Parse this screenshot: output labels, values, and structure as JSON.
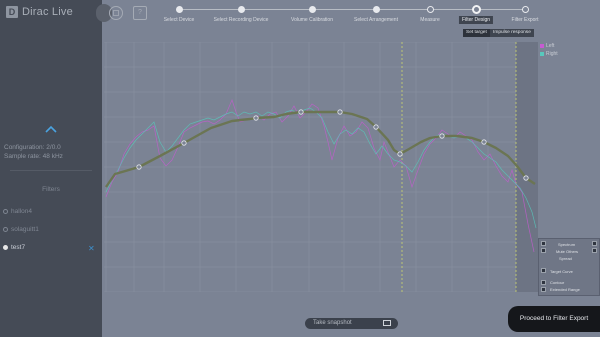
{
  "app": {
    "logo_letter": "D",
    "name": "Dirac Live"
  },
  "sidebar": {
    "configuration": "Configuration: 2/0.0",
    "sample_rate": "Sample rate: 48 kHz",
    "filters_title": "Filters",
    "filters": [
      {
        "label": "hallon4",
        "selected": false
      },
      {
        "label": "solaguitt1",
        "selected": false
      },
      {
        "label": "test7",
        "selected": true
      }
    ],
    "delete_glyph": "✕"
  },
  "toolbar": {
    "save_icon": "save-icon",
    "help_label": "?"
  },
  "steps": [
    {
      "label": "Select Device",
      "state": "done"
    },
    {
      "label": "Select Recording Device",
      "state": "done"
    },
    {
      "label": "Volume Calibration",
      "state": "done"
    },
    {
      "label": "Select Arrangement",
      "state": "done"
    },
    {
      "label": "Measure",
      "state": "upcoming"
    },
    {
      "label": "Filter Design",
      "state": "current"
    },
    {
      "label": "Filter Export",
      "state": "upcoming"
    }
  ],
  "subtabs": [
    {
      "label": "Set target",
      "selected": true
    },
    {
      "label": "Impulse response",
      "selected": false
    }
  ],
  "legend": [
    {
      "name": "Left",
      "color": "#c65bd1"
    },
    {
      "name": "Right",
      "color": "#58c9bd"
    }
  ],
  "panel": {
    "row1": "Spectrum",
    "row2": "Mute Others",
    "row3": "Spread",
    "target": "Target Curve",
    "contour": "Contour",
    "extended": "Extended Range"
  },
  "bottom": {
    "snapshot_label": "Take snapshot",
    "proceed_label": "Proceed to Filter Export"
  },
  "colors": {
    "target_curve": "#6b7553",
    "left_curve": "#c65bd1",
    "right_curve": "#58c9bd",
    "dashed_marker": "#d7e26a"
  },
  "chart_data": {
    "type": "line",
    "series": [
      {
        "name": "Target",
        "values": [
          [
            0,
            145
          ],
          [
            3,
            132
          ],
          [
            11,
            125
          ],
          [
            18,
            114
          ],
          [
            26,
            101
          ],
          [
            35,
            86
          ],
          [
            42,
            79
          ],
          [
            48,
            77
          ],
          [
            50,
            76
          ],
          [
            56,
            75
          ],
          [
            60,
            72
          ],
          [
            65,
            70
          ],
          [
            72,
            70
          ],
          [
            78,
            70
          ],
          [
            82,
            72
          ],
          [
            87,
            77
          ],
          [
            90,
            85
          ],
          [
            94,
            98
          ],
          [
            96,
            108
          ],
          [
            98,
            112
          ],
          [
            101,
            107
          ],
          [
            105,
            100
          ],
          [
            108,
            96
          ],
          [
            112,
            94
          ],
          [
            117,
            94
          ],
          [
            122,
            96
          ],
          [
            126,
            100
          ],
          [
            130,
            106
          ],
          [
            134,
            114
          ],
          [
            137,
            124
          ],
          [
            140,
            136
          ],
          [
            143,
            142
          ]
        ]
      }
    ]
  }
}
